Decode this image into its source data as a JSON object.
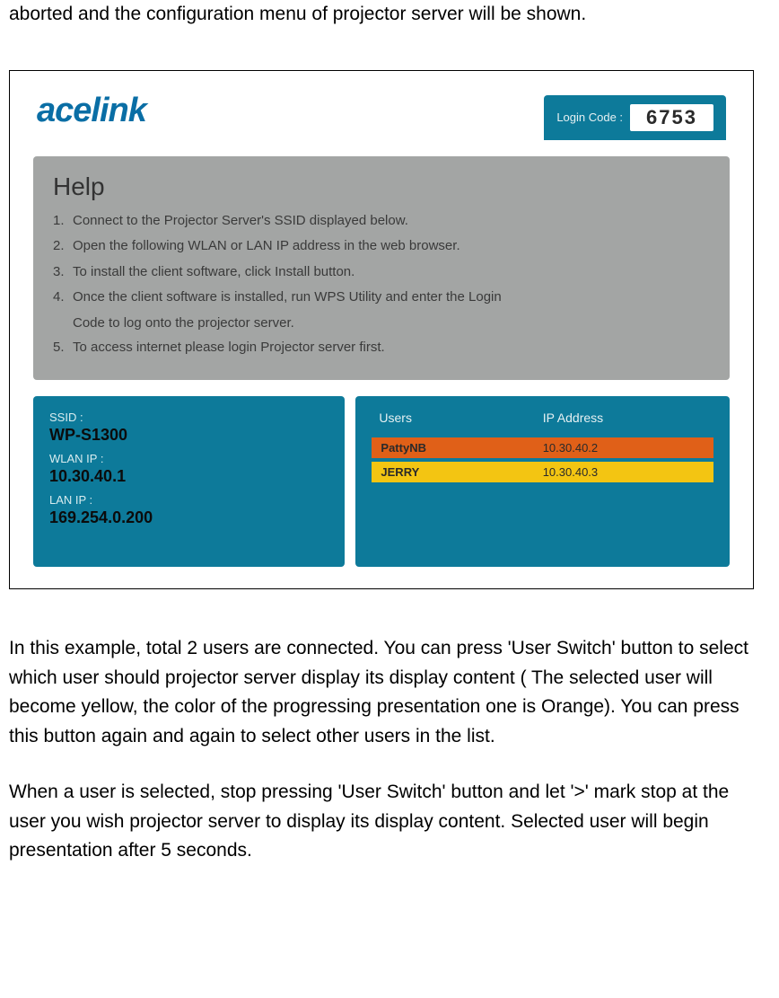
{
  "doc": {
    "top_line": "aborted and the configuration menu of projector server will be shown.",
    "para1": "In this example, total 2 users are connected. You can press 'User Switch' button to select which user should projector server display its display content ( The selected user will become yellow, the color of the progressing presentation one is Orange). You can press this button again and again to select other users in the list.",
    "para2": "When a user is selected, stop pressing 'User Switch' button and let '>' mark stop at the user you wish projector server to display its display content. Selected user will begin presentation after 5 seconds."
  },
  "ss": {
    "logo": "acelink",
    "login_label": "Login Code :",
    "login_code": "6753",
    "help": {
      "title": "Help",
      "items": [
        "Connect to the Projector Server's SSID displayed below.",
        "Open the following WLAN or LAN IP address in the web browser.",
        "To install the client software, click Install button.",
        "Once the client software is installed, run WPS Utility and enter the Login",
        "Code to log onto the projector server.",
        "To access internet please login Projector server first."
      ]
    },
    "net": {
      "ssid_label": "SSID :",
      "ssid_value": "WP-S1300",
      "wlan_label": "WLAN IP :",
      "wlan_value": "10.30.40.1",
      "lan_label": "LAN IP :",
      "lan_value": "169.254.0.200"
    },
    "users": {
      "col1": "Users",
      "col2": "IP Address",
      "rows": [
        {
          "name": "PattyNB",
          "ip": "10.30.40.2",
          "color": "orange"
        },
        {
          "name": "JERRY",
          "ip": "10.30.40.3",
          "color": "yellow"
        }
      ]
    }
  }
}
